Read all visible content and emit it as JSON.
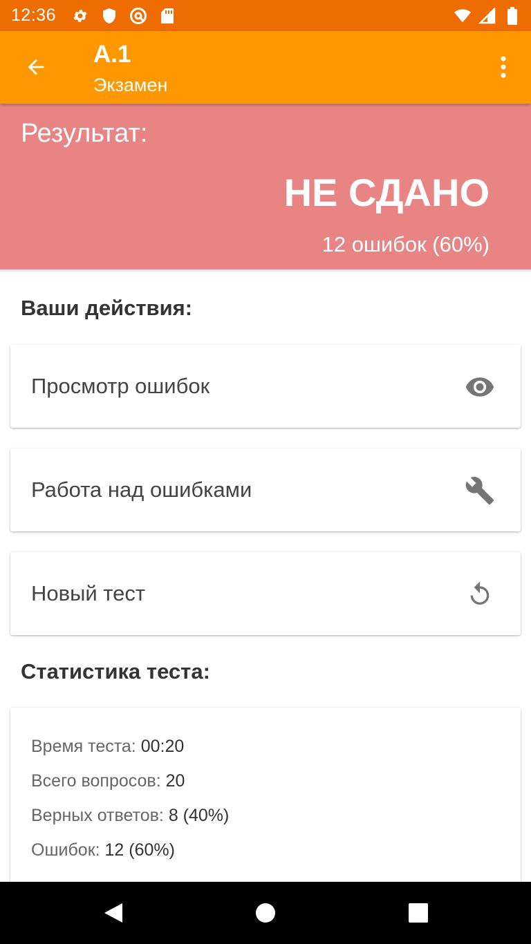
{
  "status_bar": {
    "time": "12:36",
    "left_icons": [
      "gear-icon",
      "shield-icon",
      "at-sign-icon",
      "sd-card-icon"
    ],
    "right_icons": [
      "wifi-icon",
      "cell-signal-icon",
      "battery-icon"
    ]
  },
  "app_bar": {
    "title": "A.1",
    "subtitle": "Экзамен",
    "background_color": "#ff9800"
  },
  "result": {
    "label": "Результат:",
    "status": "НЕ СДАНО",
    "detail": "12 ошибок (60%)",
    "background_color": "#e88484"
  },
  "actions": {
    "title": "Ваши действия:",
    "items": [
      {
        "label": "Просмотр ошибок",
        "icon": "eye-icon"
      },
      {
        "label": "Работа над ошибками",
        "icon": "wrench-icon"
      },
      {
        "label": "Новый тест",
        "icon": "refresh-icon"
      }
    ]
  },
  "stats": {
    "title": "Статистика теста:",
    "rows": [
      {
        "label": "Время теста: ",
        "value": "00:20"
      },
      {
        "label": "Всего вопросов: ",
        "value": "20"
      },
      {
        "label": "Верных ответов: ",
        "value": "8 (40%)"
      },
      {
        "label": "Ошибок: ",
        "value": "12 (60%)"
      }
    ]
  },
  "nav_bar": {
    "buttons": [
      "back-triangle-icon",
      "home-circle-icon",
      "recents-square-icon"
    ]
  }
}
